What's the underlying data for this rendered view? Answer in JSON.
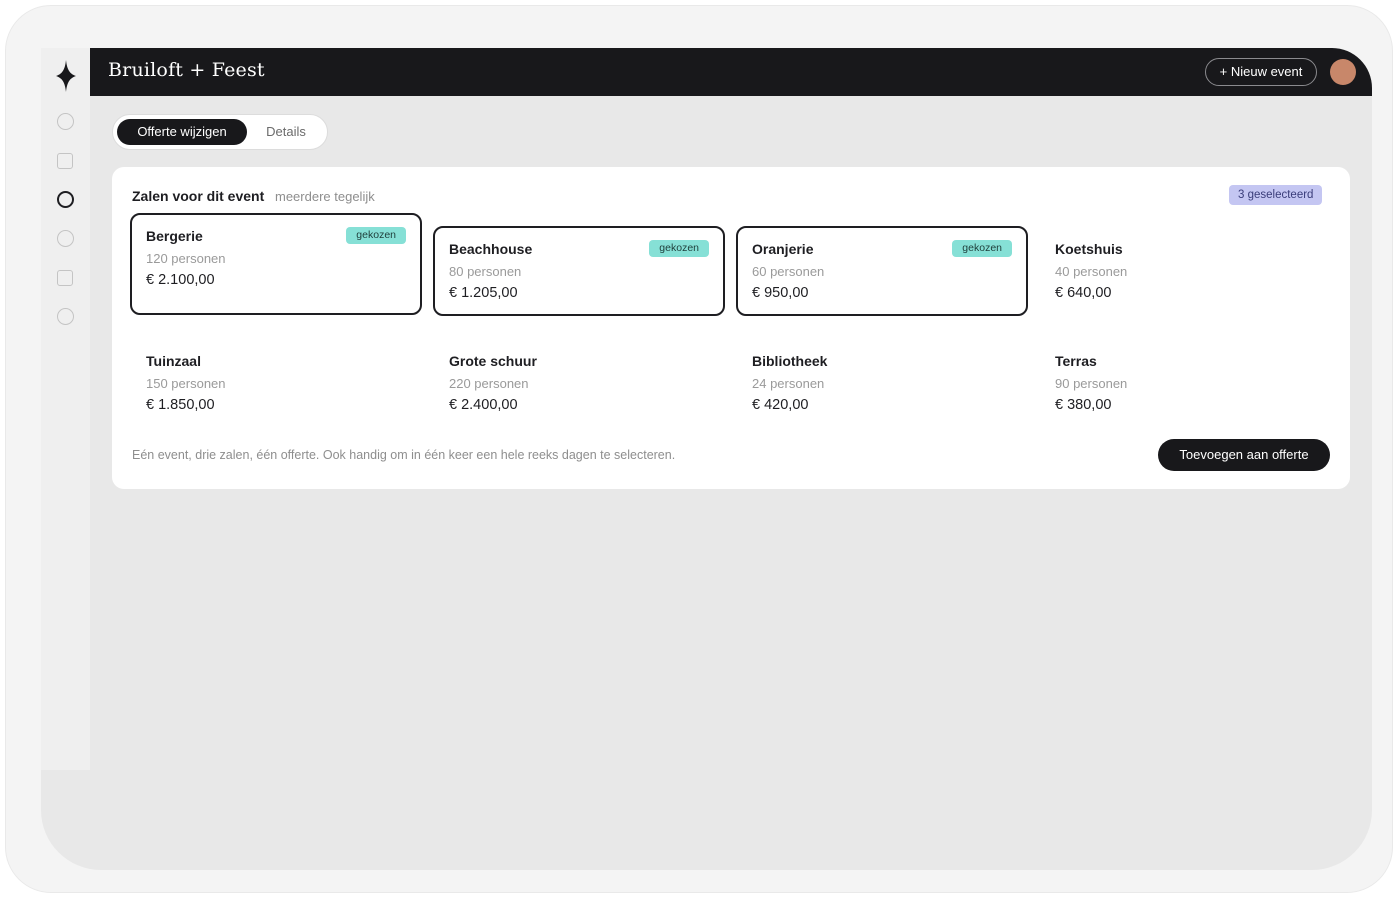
{
  "app": {
    "brand": "Bruiloft + Feest",
    "new_event_label": "+ Nieuw event"
  },
  "tabs": [
    {
      "label": "Offerte wijzigen",
      "active": true
    },
    {
      "label": "Details",
      "active": false
    }
  ],
  "sidebar": {
    "icons": [
      "circle-icon",
      "square-icon",
      "circle-icon",
      "circle-icon",
      "square-icon",
      "circle-icon"
    ],
    "active_index": 2
  },
  "rooms_section": {
    "title": "Zalen voor dit event",
    "subtitle": "meerdere tegelijk",
    "selected_badge": "3 geselecteerd",
    "chosen_label": "gekozen",
    "rooms": [
      {
        "name": "Bergerie",
        "capacity": "120 personen",
        "price": "€ 2.100,00",
        "selected": true
      },
      {
        "name": "Beachhouse",
        "capacity": "80 personen",
        "price": "€ 1.205,00",
        "selected": true
      },
      {
        "name": "Oranjerie",
        "capacity": "60 personen",
        "price": "€ 950,00",
        "selected": true
      },
      {
        "name": "Koetshuis",
        "capacity": "40 personen",
        "price": "€ 640,00",
        "selected": false
      },
      {
        "name": "Tuinzaal",
        "capacity": "150 personen",
        "price": "€ 1.850,00",
        "selected": false
      },
      {
        "name": "Grote schuur",
        "capacity": "220 personen",
        "price": "€ 2.400,00",
        "selected": false
      },
      {
        "name": "Bibliotheek",
        "capacity": "24 personen",
        "price": "€ 420,00",
        "selected": false
      },
      {
        "name": "Terras",
        "capacity": "90 personen",
        "price": "€ 380,00",
        "selected": false
      }
    ],
    "footnote": "Eén event, drie zalen, één offerte. Ook handig om in één keer een hele reeks dagen te selecteren.",
    "add_button": "Toevoegen aan offerte"
  },
  "colors": {
    "topbar": "#18181b",
    "chosen_badge": "#86e0d6",
    "selected_badge": "#c4c6f2",
    "avatar": "#c8876a"
  }
}
